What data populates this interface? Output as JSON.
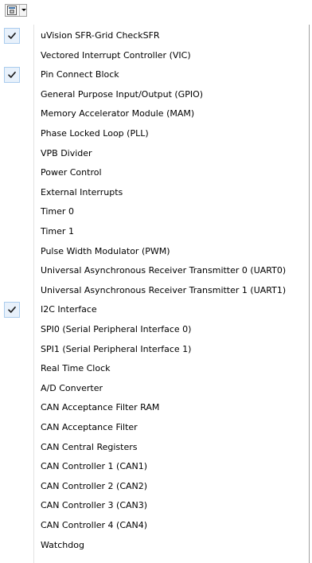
{
  "menu": {
    "items": [
      {
        "label": "uVision SFR-Grid CheckSFR",
        "checked": true
      },
      {
        "label": "Vectored Interrupt Controller (VIC)",
        "checked": false
      },
      {
        "label": "Pin Connect Block",
        "checked": true
      },
      {
        "label": "General Purpose Input/Output (GPIO)",
        "checked": false
      },
      {
        "label": "Memory Accelerator Module (MAM)",
        "checked": false
      },
      {
        "label": "Phase Locked Loop (PLL)",
        "checked": false
      },
      {
        "label": "VPB Divider",
        "checked": false
      },
      {
        "label": "Power Control",
        "checked": false
      },
      {
        "label": "External Interrupts",
        "checked": false
      },
      {
        "label": "Timer 0",
        "checked": false
      },
      {
        "label": "Timer 1",
        "checked": false
      },
      {
        "label": "Pulse Width Modulator (PWM)",
        "checked": false
      },
      {
        "label": "Universal Asynchronous Receiver Transmitter 0 (UART0)",
        "checked": false
      },
      {
        "label": "Universal Asynchronous Receiver Transmitter 1 (UART1)",
        "checked": false
      },
      {
        "label": "I2C Interface",
        "checked": true
      },
      {
        "label": "SPI0 (Serial Peripheral Interface 0)",
        "checked": false
      },
      {
        "label": "SPI1 (Serial Peripheral Interface 1)",
        "checked": false
      },
      {
        "label": "Real Time Clock",
        "checked": false
      },
      {
        "label": "A/D Converter",
        "checked": false
      },
      {
        "label": "CAN Acceptance Filter RAM",
        "checked": false
      },
      {
        "label": "CAN Acceptance Filter",
        "checked": false
      },
      {
        "label": "CAN Central Registers",
        "checked": false
      },
      {
        "label": "CAN Controller 1 (CAN1)",
        "checked": false
      },
      {
        "label": "CAN Controller 2 (CAN2)",
        "checked": false
      },
      {
        "label": "CAN Controller 3 (CAN3)",
        "checked": false
      },
      {
        "label": "CAN Controller 4 (CAN4)",
        "checked": false
      },
      {
        "label": "Watchdog",
        "checked": false
      }
    ]
  },
  "toolbar": {
    "button_icon": "peripheral-window-icon",
    "dropdown_icon": "chevron-down-icon"
  },
  "colors": {
    "check_background": "#e8f1fb",
    "check_border": "#aaccee",
    "menu_border": "#a0a0a0"
  }
}
